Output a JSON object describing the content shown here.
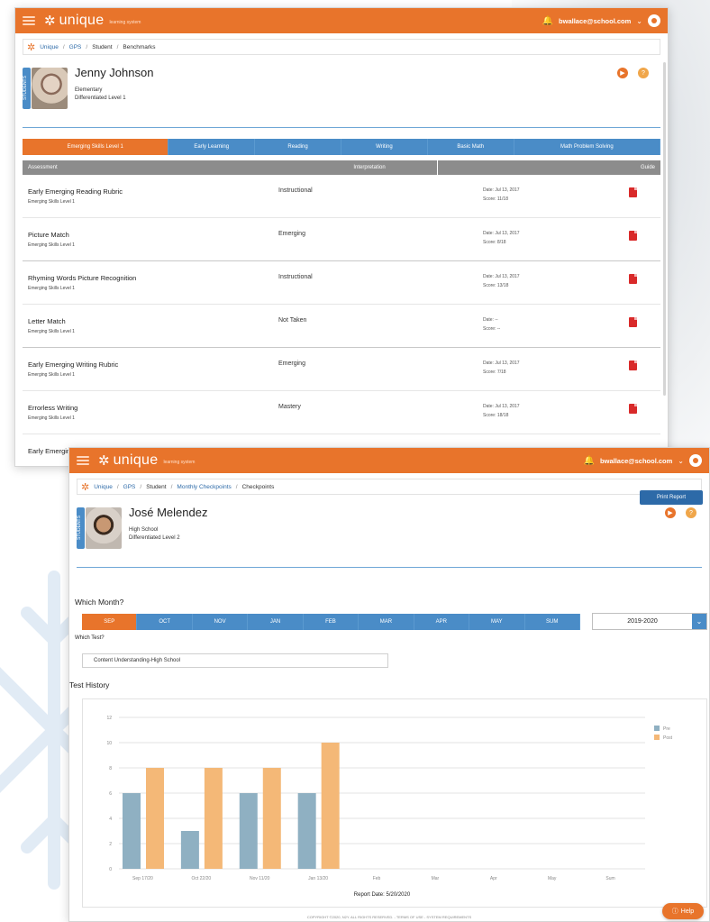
{
  "brand": {
    "name": "unique",
    "tagline": "learning system",
    "accent": "#e8742b",
    "blue": "#4a8cc7"
  },
  "user": {
    "email": "bwallace@school.com"
  },
  "window1": {
    "breadcrumb": [
      "Unique",
      "GPS",
      "Student",
      "Benchmarks"
    ],
    "student": {
      "name": "Jenny Johnson",
      "grade": "Elementary",
      "level": "Differentiated Level 1",
      "tab_label": "STUDENTS"
    },
    "tabs": [
      "Emerging Skills Level 1",
      "Early Learning",
      "Reading",
      "Writing",
      "Basic Math",
      "Math Problem Solving"
    ],
    "table": {
      "headers": [
        "Assessment",
        "Interpretation",
        "",
        "Guide"
      ],
      "rows": [
        {
          "name": "Early Emerging Reading Rubric",
          "sub": "Emerging Skills Level 1",
          "interpretation": "Instructional",
          "date": "Date: Jul 13, 2017",
          "score": "Score: 11/18"
        },
        {
          "name": "Picture Match",
          "sub": "Emerging Skills Level 1",
          "interpretation": "Emerging",
          "date": "Date: Jul 13, 2017",
          "score": "Score: 8/18"
        },
        {
          "name": "Rhyming Words Picture Recognition",
          "sub": "Emerging Skills Level 1",
          "interpretation": "Instructional",
          "date": "Date: Jul 13, 2017",
          "score": "Score: 13/18"
        },
        {
          "name": "Letter Match",
          "sub": "Emerging Skills Level 1",
          "interpretation": "Not Taken",
          "date": "Date: --",
          "score": "Score: --"
        },
        {
          "name": "Early Emerging Writing Rubric",
          "sub": "Emerging Skills Level 1",
          "interpretation": "Emerging",
          "date": "Date: Jul 13, 2017",
          "score": "Score: 7/18"
        },
        {
          "name": "Errorless Writing",
          "sub": "Emerging Skills Level 1",
          "interpretation": "Mastery",
          "date": "Date: Jul 13, 2017",
          "score": "Score: 18/18"
        },
        {
          "name": "Early Emerging",
          "sub": "",
          "interpretation": "",
          "date": "",
          "score": ""
        }
      ]
    }
  },
  "window2": {
    "breadcrumb": [
      "Unique",
      "GPS",
      "Student",
      "Monthly Checkpoints",
      "Checkpoints"
    ],
    "student": {
      "name": "José Melendez",
      "grade": "High School",
      "level": "Differentiated Level 2",
      "tab_label": "STUDENTS"
    },
    "print_label": "Print Report",
    "which_month": "Which Month?",
    "months": [
      "SEP",
      "OCT",
      "NOV",
      "JAN",
      "FEB",
      "MAR",
      "APR",
      "MAY",
      "SUM"
    ],
    "year": "2019-2020",
    "which_test": "Which Test?",
    "test_value": "Content Understanding-High School",
    "test_history": "Test History",
    "footer": "COPYRIGHT ©2020, N2Y. ALL RIGHTS RESERVED. - TERMS OF USE - SYSTEM REQUIREMENTS",
    "help_label": "Help"
  },
  "chart_data": {
    "type": "bar",
    "categories": [
      "Sep 17/20",
      "Oct 22/20",
      "Nov 11/20",
      "Jan 13/20",
      "Feb",
      "Mar",
      "Apr",
      "May",
      "Sum"
    ],
    "series": [
      {
        "name": "Pre",
        "color": "#8fb0c2",
        "values": [
          6,
          3,
          6,
          6,
          null,
          null,
          null,
          null,
          null
        ]
      },
      {
        "name": "Post",
        "color": "#f4b877",
        "values": [
          8,
          8,
          8,
          10,
          null,
          null,
          null,
          null,
          null
        ]
      }
    ],
    "ylim": [
      0,
      12
    ],
    "yticks": [
      0,
      2,
      4,
      6,
      8,
      10,
      12
    ],
    "xlabel": "Report Date: 5/20/2020",
    "legend": "top-right",
    "grid": true
  }
}
